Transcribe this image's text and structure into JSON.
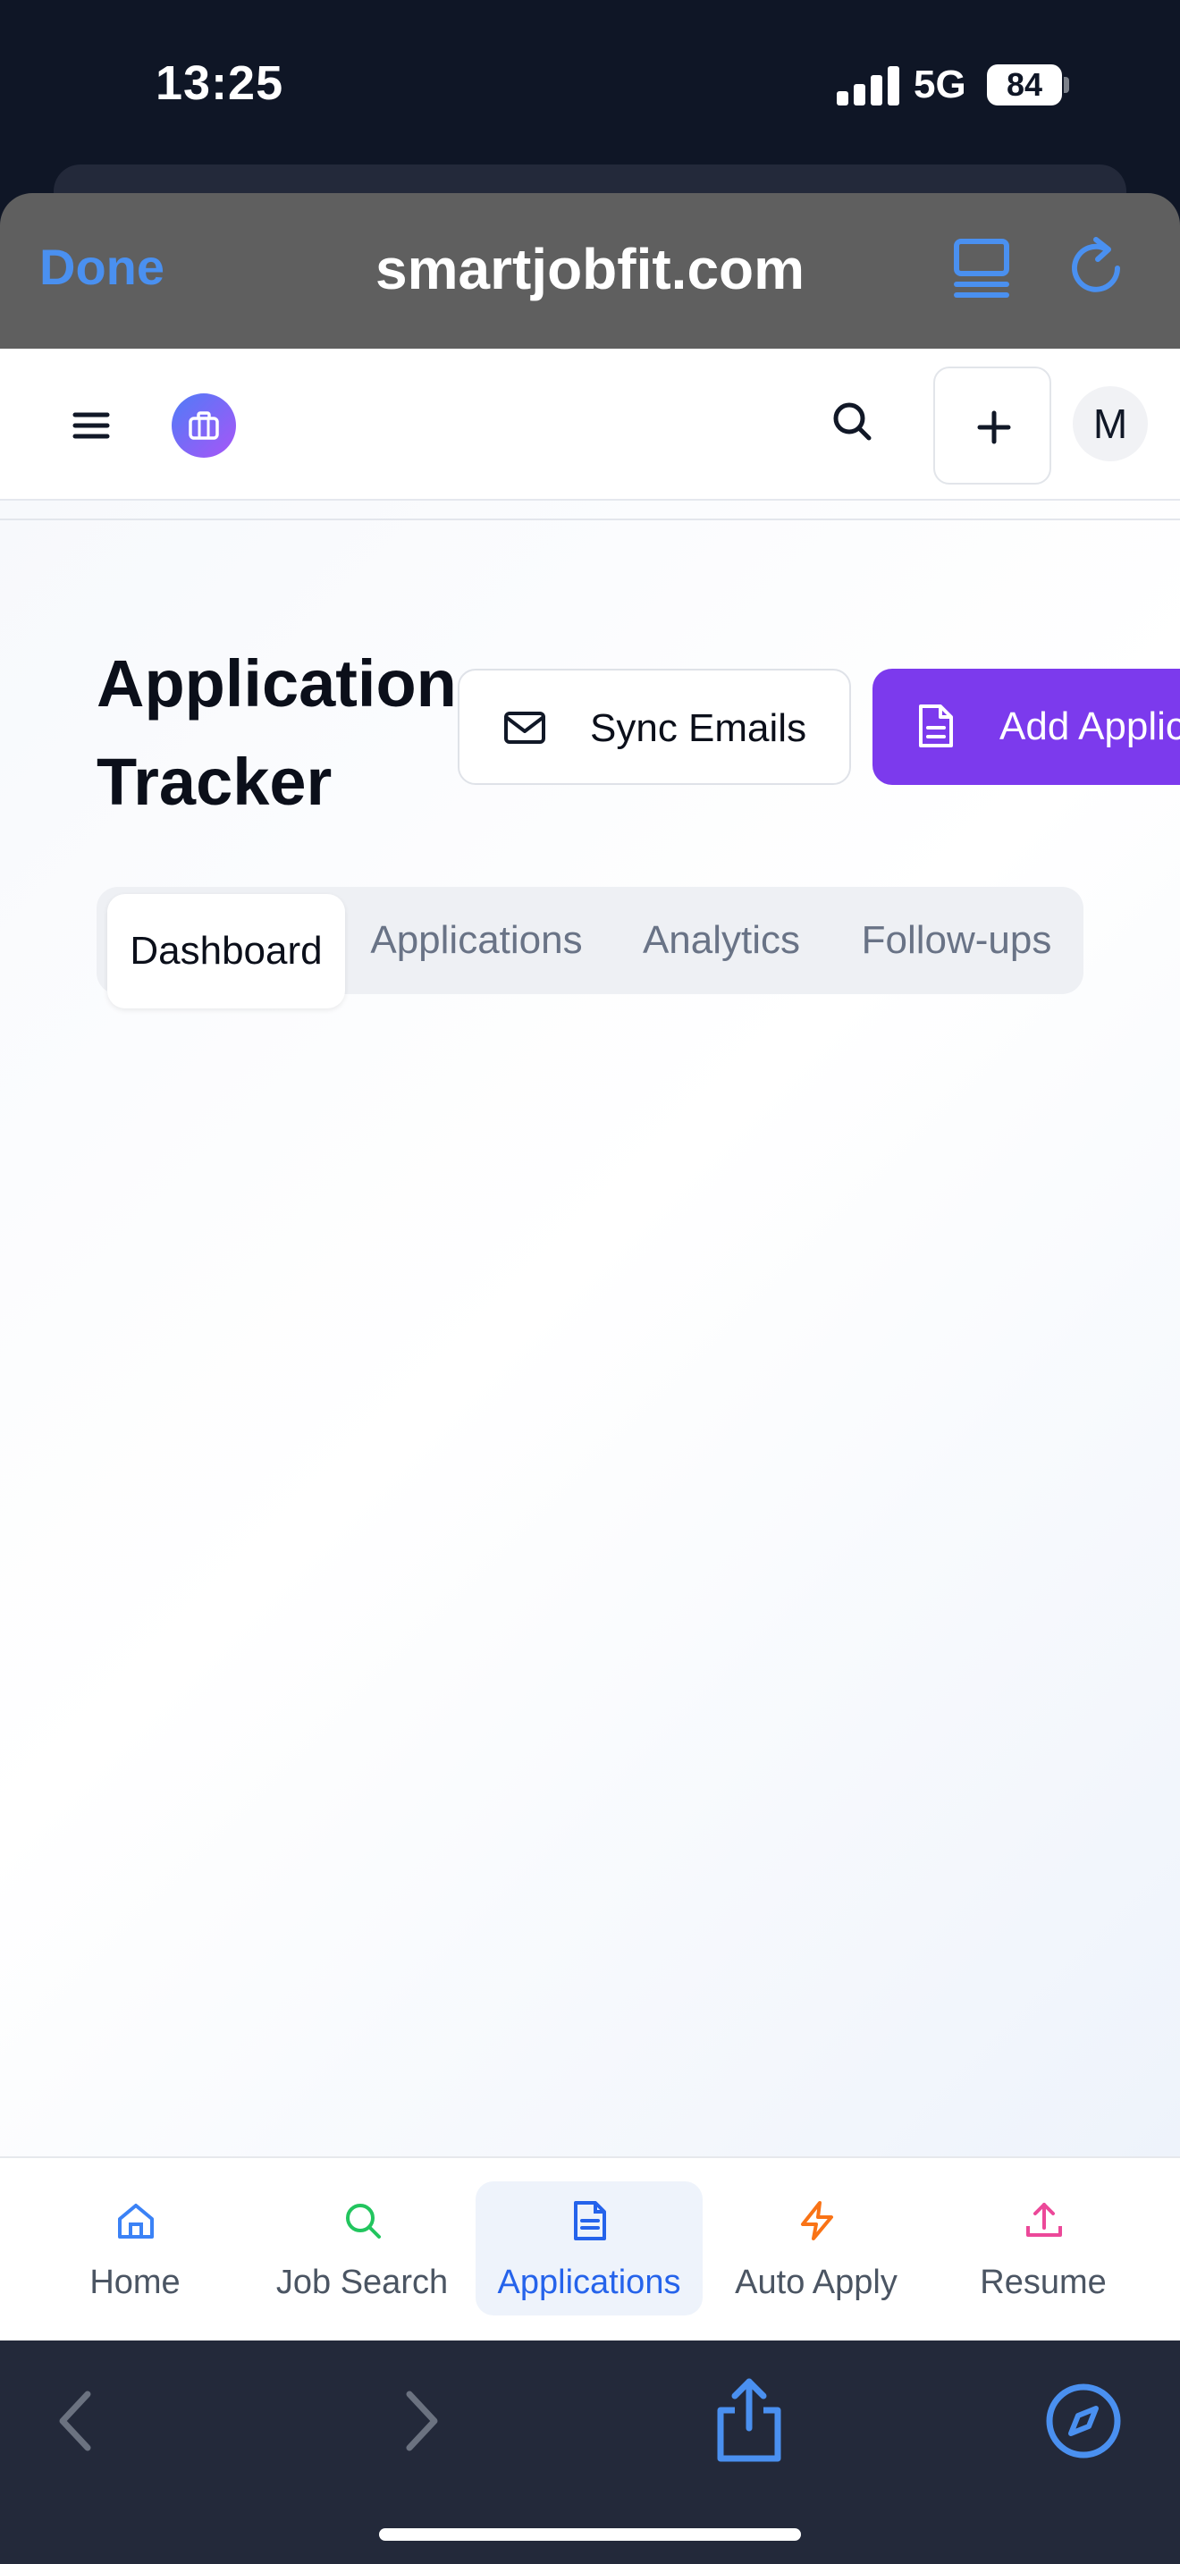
{
  "status_bar": {
    "time": "13:25",
    "network": "5G",
    "battery": "84"
  },
  "browser": {
    "done_label": "Done",
    "site": "smartjobfit.com",
    "accent": "#4a90f0"
  },
  "app_header": {
    "avatar_initial": "M",
    "brand_color_start": "#4f7cf7",
    "brand_color_end": "#a855f7"
  },
  "main": {
    "title": "Application Tracker",
    "sync_label": "Sync Emails",
    "add_label": "Add Application",
    "add_color": "#7c3aed",
    "tabs": [
      {
        "label": "Dashboard",
        "active": true
      },
      {
        "label": "Applications",
        "active": false
      },
      {
        "label": "Analytics",
        "active": false
      },
      {
        "label": "Follow-ups",
        "active": false
      }
    ]
  },
  "bottom_nav": {
    "items": [
      {
        "label": "Home",
        "icon": "home-icon",
        "color": "#3b82f6",
        "active": false
      },
      {
        "label": "Job Search",
        "icon": "search-icon",
        "color": "#22c55e",
        "active": false
      },
      {
        "label": "Applications",
        "icon": "file-icon",
        "color": "#2563eb",
        "active": true
      },
      {
        "label": "Auto Apply",
        "icon": "zap-icon",
        "color": "#f97316",
        "active": false
      },
      {
        "label": "Resume",
        "icon": "upload-icon",
        "color": "#ec4899",
        "active": false
      }
    ]
  }
}
